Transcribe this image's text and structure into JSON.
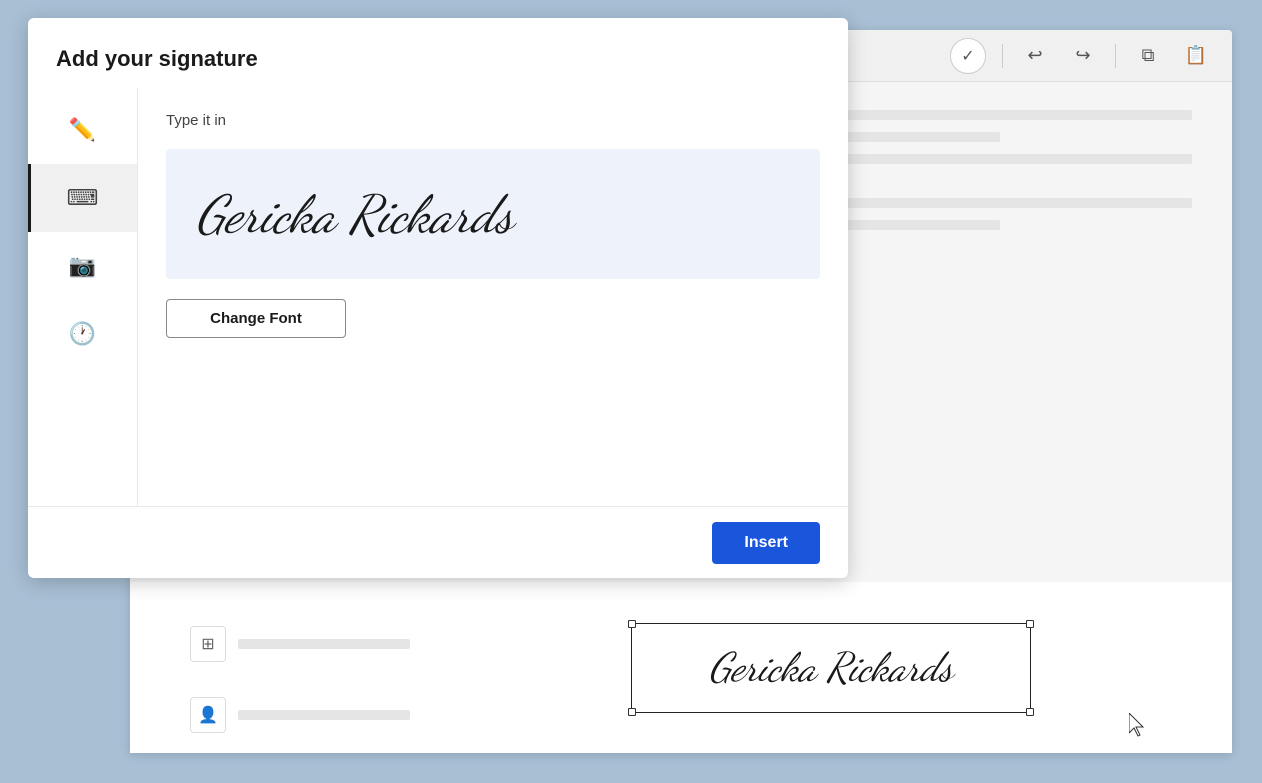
{
  "modal": {
    "title": "Add your signature",
    "tab_type_label": "Type it in",
    "signature_text": "Gericka Rickards",
    "change_font_label": "Change Font",
    "insert_label": "Insert"
  },
  "sidebar": {
    "items": [
      {
        "icon": "✏️",
        "label": "draw",
        "active": false
      },
      {
        "icon": "⌨",
        "label": "type",
        "active": true
      },
      {
        "icon": "📷",
        "label": "upload",
        "active": false
      },
      {
        "icon": "🕐",
        "label": "history",
        "active": false
      }
    ]
  },
  "toolbar": {
    "check_icon": "✓",
    "undo_icon": "↩",
    "redo_icon": "↪",
    "copy_icon": "⧉",
    "paste_icon": "📋"
  },
  "document": {
    "sig_text": "Gericka Rickards"
  },
  "colors": {
    "insert_btn_bg": "#1a56db",
    "sig_preview_bg": "#eef2fb",
    "modal_bg": "#ffffff",
    "page_bg": "#a8bfd4"
  }
}
